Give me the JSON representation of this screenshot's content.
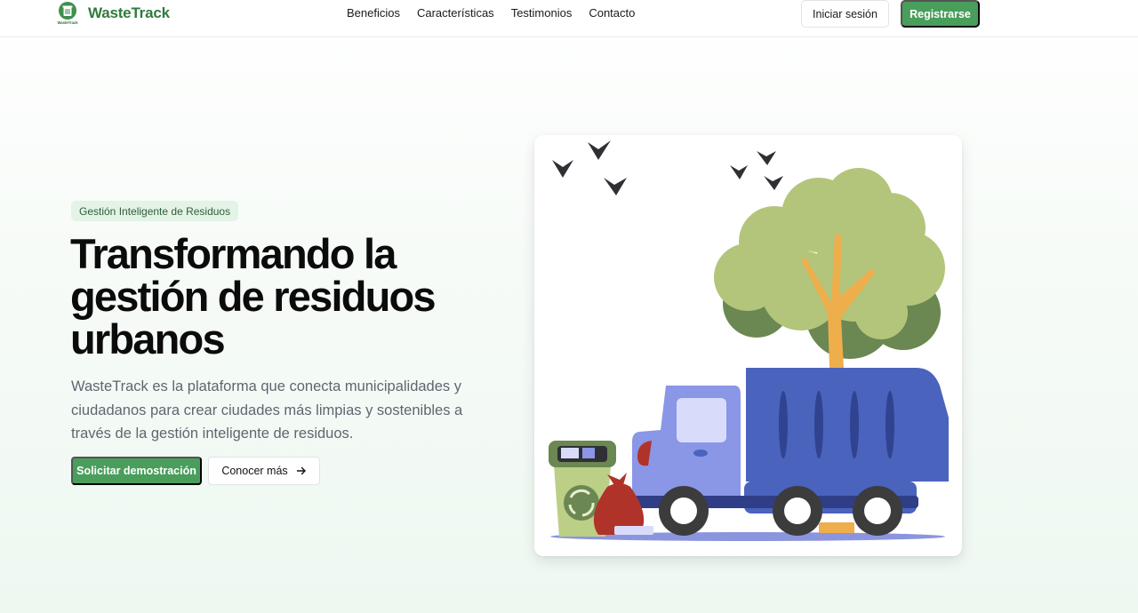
{
  "header": {
    "brand": "WasteTrack",
    "nav": [
      "Beneficios",
      "Características",
      "Testimonios",
      "Contacto"
    ],
    "login_label": "Iniciar sesión",
    "register_label": "Registrarse"
  },
  "hero": {
    "badge": "Gestión Inteligente de Residuos",
    "title_lines": [
      "Transformando la",
      "gestión de residuos",
      "urbanos"
    ],
    "description": "WasteTrack es la plataforma que conecta municipalidades y ciudadanos para crear ciudades más limpias y sostenibles a través de la gestión inteligente de residuos.",
    "primary_cta": "Solicitar demostración",
    "secondary_cta": "Conocer más"
  },
  "colors": {
    "brand_green": "#4a9e5c",
    "truck_blue": "#4a63bd",
    "tree_green": "#b3c57a"
  },
  "icons": {
    "logo": "trash-bin-logo",
    "arrow": "arrow-right-icon",
    "illustration": "garbage-truck-illustration"
  }
}
